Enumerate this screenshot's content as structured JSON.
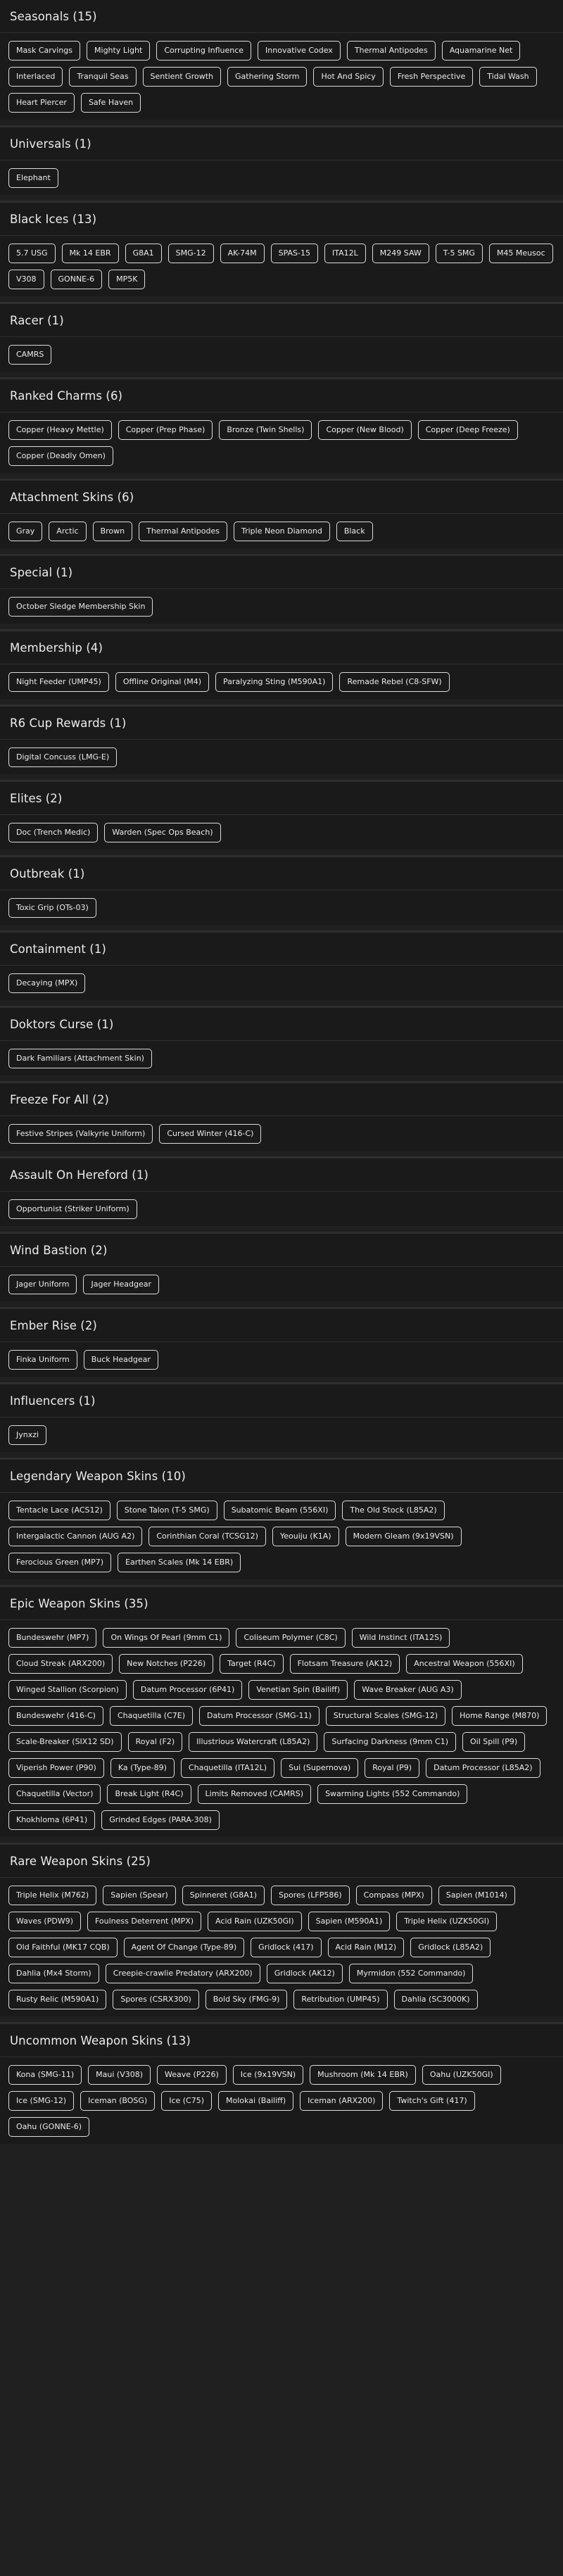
{
  "sections": [
    {
      "title": "Seasonals (15)",
      "items": [
        "Mask Carvings",
        "Mighty Light",
        "Corrupting Influence",
        "Innovative Codex",
        "Thermal Antipodes",
        "Aquamarine Net",
        "Interlaced",
        "Tranquil Seas",
        "Sentient Growth",
        "Gathering Storm",
        "Hot And Spicy",
        "Fresh Perspective",
        "Tidal Wash",
        "Heart Piercer",
        "Safe Haven"
      ]
    },
    {
      "title": "Universals (1)",
      "items": [
        "Elephant"
      ]
    },
    {
      "title": "Black Ices (13)",
      "items": [
        "5.7 USG",
        "Mk 14 EBR",
        "G8A1",
        "SMG-12",
        "AK-74M",
        "SPAS-15",
        "ITA12L",
        "M249 SAW",
        "T-5 SMG",
        "M45 Meusoc",
        "V308",
        "GONNE-6",
        "MP5K"
      ]
    },
    {
      "title": "Racer (1)",
      "items": [
        "CAMRS"
      ]
    },
    {
      "title": "Ranked Charms (6)",
      "items": [
        "Copper (Heavy Mettle)",
        "Copper (Prep Phase)",
        "Bronze (Twin Shells)",
        "Copper (New Blood)",
        "Copper (Deep Freeze)",
        "Copper (Deadly Omen)"
      ]
    },
    {
      "title": "Attachment Skins (6)",
      "items": [
        "Gray",
        "Arctic",
        "Brown",
        "Thermal Antipodes",
        "Triple Neon Diamond",
        "Black"
      ]
    },
    {
      "title": "Special (1)",
      "items": [
        "October Sledge Membership Skin"
      ]
    },
    {
      "title": "Membership (4)",
      "items": [
        "Night Feeder (UMP45)",
        "Offline Original (M4)",
        "Paralyzing Sting (M590A1)",
        "Remade Rebel (C8-SFW)"
      ]
    },
    {
      "title": "R6 Cup Rewards (1)",
      "items": [
        "Digital Concuss (LMG-E)"
      ]
    },
    {
      "title": "Elites (2)",
      "items": [
        "Doc (Trench Medic)",
        "Warden (Spec Ops Beach)"
      ]
    },
    {
      "title": "Outbreak (1)",
      "items": [
        "Toxic Grip (OTs-03)"
      ]
    },
    {
      "title": "Containment (1)",
      "items": [
        "Decaying (MPX)"
      ]
    },
    {
      "title": "Doktors Curse (1)",
      "items": [
        "Dark Familiars (Attachment Skin)"
      ]
    },
    {
      "title": "Freeze For All (2)",
      "items": [
        "Festive Stripes (Valkyrie Uniform)",
        "Cursed Winter (416-C)"
      ]
    },
    {
      "title": "Assault On Hereford (1)",
      "items": [
        "Opportunist (Striker Uniform)"
      ]
    },
    {
      "title": "Wind Bastion (2)",
      "items": [
        "Jager Uniform",
        "Jager Headgear"
      ]
    },
    {
      "title": "Ember Rise (2)",
      "items": [
        "Finka Uniform",
        "Buck Headgear"
      ]
    },
    {
      "title": "Influencers (1)",
      "items": [
        "Jynxzi"
      ]
    },
    {
      "title": "Legendary Weapon Skins (10)",
      "items": [
        "Tentacle Lace (ACS12)",
        "Stone Talon (T-5 SMG)",
        "Subatomic Beam (556XI)",
        "The Old Stock (L85A2)",
        "Intergalactic Cannon (AUG A2)",
        "Corinthian Coral (TCSG12)",
        "Yeouiju (K1A)",
        "Modern Gleam (9x19VSN)",
        "Ferocious Green (MP7)",
        "Earthen Scales (Mk 14 EBR)"
      ]
    },
    {
      "title": "Epic Weapon Skins (35)",
      "items": [
        "Bundeswehr (MP7)",
        "On Wings Of Pearl (9mm C1)",
        "Coliseum Polymer (C8C)",
        "Wild Instinct (ITA12S)",
        "Cloud Streak (ARX200)",
        "New Notches (P226)",
        "Target (R4C)",
        "Flotsam Treasure (AK12)",
        "Ancestral Weapon (556XI)",
        "Winged Stallion (Scorpion)",
        "Datum Processor (6P41)",
        "Venetian Spin (Bailiff)",
        "Wave Breaker (AUG A3)",
        "Bundeswehr (416-C)",
        "Chaquetilla (C7E)",
        "Datum Processor (SMG-11)",
        "Structural Scales (SMG-12)",
        "Home Range (M870)",
        "Scale-Breaker (SIX12 SD)",
        "Royal (F2)",
        "Illustrious Watercraft (L85A2)",
        "Surfacing Darkness (9mm C1)",
        "Oil Spill (P9)",
        "Viperish Power (P90)",
        "Ka (Type-89)",
        "Chaquetilla (ITA12L)",
        "Sui (Supernova)",
        "Royal (P9)",
        "Datum Processor (L85A2)",
        "Chaquetilla (Vector)",
        "Break Light (R4C)",
        "Limits Removed (CAMRS)",
        "Swarming Lights (552 Commando)",
        "Khokhloma (6P41)",
        "Grinded Edges (PARA-308)"
      ]
    },
    {
      "title": "Rare Weapon Skins (25)",
      "items": [
        "Triple Helix (M762)",
        "Sapien (Spear)",
        "Spinneret (G8A1)",
        "Spores (LFP586)",
        "Compass (MPX)",
        "Sapien (M1014)",
        "Waves (PDW9)",
        "Foulness Deterrent (MPX)",
        "Acid Rain (UZK50GI)",
        "Sapien (M590A1)",
        "Triple Helix (UZK50GI)",
        "Old Faithful (MK17 CQB)",
        "Agent Of Change (Type-89)",
        "Gridlock (417)",
        "Acid Rain (M12)",
        "Gridlock (L85A2)",
        "Dahlia (Mx4 Storm)",
        "Creepie-crawlie Predatory (ARX200)",
        "Gridlock (AK12)",
        "Myrmidon (552 Commando)",
        "Rusty Relic (M590A1)",
        "Spores (CSRX300)",
        "Bold Sky (FMG-9)",
        "Retribution (UMP45)",
        "Dahlia (SC3000K)"
      ]
    },
    {
      "title": "Uncommon Weapon Skins (13)",
      "items": [
        "Kona (SMG-11)",
        "Maui (V308)",
        "Weave (P226)",
        "Ice (9x19VSN)",
        "Mushroom (Mk 14 EBR)",
        "Oahu (UZK50GI)",
        "Ice (SMG-12)",
        "Iceman (BOSG)",
        "Ice (C75)",
        "Molokai (Bailiff)",
        "Iceman (ARX200)",
        "Twitch's Gift (417)",
        "Oahu (GONNE-6)"
      ]
    }
  ]
}
